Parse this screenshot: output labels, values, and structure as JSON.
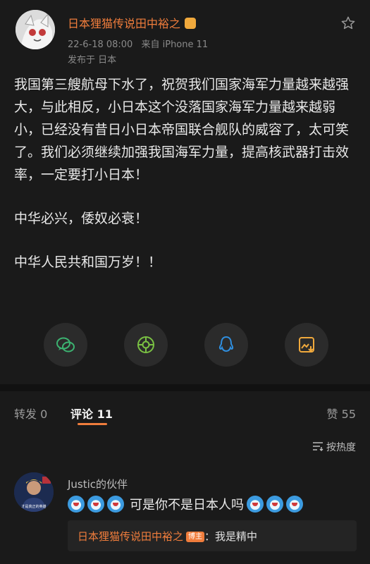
{
  "post": {
    "author": "日本狸猫传说田中裕之",
    "timestamp": "22-6-18 08:00",
    "source": "来自 iPhone 11",
    "location": "发布于 日本",
    "paragraphs": [
      "我国第三艘航母下水了，祝贺我们国家海军力量越来越强大，与此相反，小日本这个没落国家海军力量越来越弱小，已经没有昔日小日本帝国联合舰队的威容了，太可笑了。我们必须继续加强我国海军力量，提高核武器打击效率，一定要打小日本！",
      "中华必兴，倭奴必衰！",
      "中华人民共和国万岁！！"
    ]
  },
  "share": {
    "icons": [
      "wechat-icon",
      "moments-icon",
      "qq-icon",
      "save-image-icon"
    ],
    "colors": [
      "#3cb371",
      "#7ac143",
      "#2f8fe0",
      "#f0a93c"
    ]
  },
  "tabs": {
    "repost": "转发 0",
    "comments": "评论 11",
    "likes": "赞 55"
  },
  "sort": {
    "label": "按热度"
  },
  "comment": {
    "user": "Justic的伙伴",
    "avatar_caption": "才是真正的英雄",
    "text": "可是你不是日本人吗",
    "reply": {
      "author": "日本狸猫传说田中裕之",
      "badge": "博主",
      "text": "：我是精中"
    }
  },
  "accent_color": "#f07d3c"
}
